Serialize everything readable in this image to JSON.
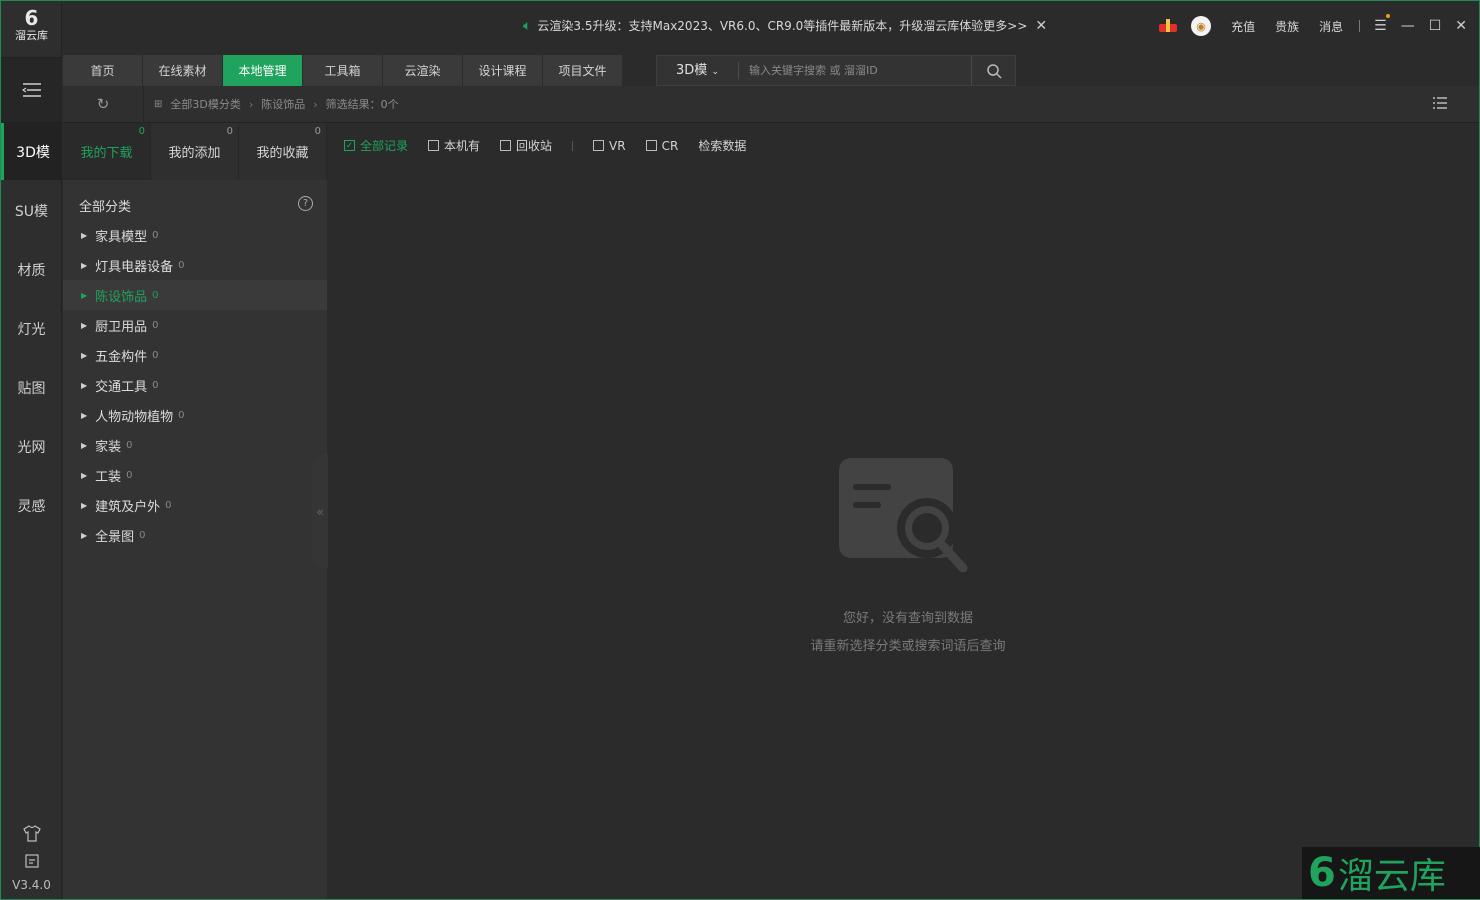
{
  "app": {
    "logo_mark": "6",
    "logo_name": "溜云库",
    "version": "V3.4.0",
    "brand_mark": "6",
    "brand_name": "溜云库"
  },
  "titlebar": {
    "notice": "云渲染3.5升级：支持Max2023、VR6.0、CR9.0等插件最新版本，升级溜云库体验更多>>",
    "links": [
      "充值",
      "贵族",
      "消息"
    ],
    "accent": "#1fa35d"
  },
  "rail": {
    "items": [
      "3D模",
      "SU模",
      "材质",
      "灯光",
      "贴图",
      "光网",
      "灵感"
    ],
    "active": "3D模"
  },
  "tabs": {
    "items": [
      "首页",
      "在线素材",
      "本地管理",
      "工具箱",
      "云渲染",
      "设计课程",
      "项目文件"
    ],
    "active": "本地管理"
  },
  "search": {
    "type": "3D模",
    "placeholder": "输入关键字搜索 或 溜溜ID"
  },
  "breadcrumb": {
    "root": "全部3D模分类",
    "current": "陈设饰品",
    "result": "筛选结果：0个"
  },
  "subtabs": [
    {
      "label": "我的下载",
      "count": "0"
    },
    {
      "label": "我的添加",
      "count": "0"
    },
    {
      "label": "我的收藏",
      "count": "0"
    }
  ],
  "categories": {
    "header": "全部分类",
    "items": [
      {
        "label": "家具模型",
        "count": "0"
      },
      {
        "label": "灯具电器设备",
        "count": "0"
      },
      {
        "label": "陈设饰品",
        "count": "0"
      },
      {
        "label": "厨卫用品",
        "count": "0"
      },
      {
        "label": "五金构件",
        "count": "0"
      },
      {
        "label": "交通工具",
        "count": "0"
      },
      {
        "label": "人物动物植物",
        "count": "0"
      },
      {
        "label": "家装",
        "count": "0"
      },
      {
        "label": "工装",
        "count": "0"
      },
      {
        "label": "建筑及户外",
        "count": "0"
      },
      {
        "label": "全景图",
        "count": "0"
      }
    ]
  },
  "filters": {
    "all": "全部记录",
    "local": "本机有",
    "recycle": "回收站",
    "vr": "VR",
    "cr": "CR",
    "check": "检索数据"
  },
  "empty": {
    "line1": "您好，没有查询到数据",
    "line2": "请重新选择分类或搜索词语后查询"
  }
}
